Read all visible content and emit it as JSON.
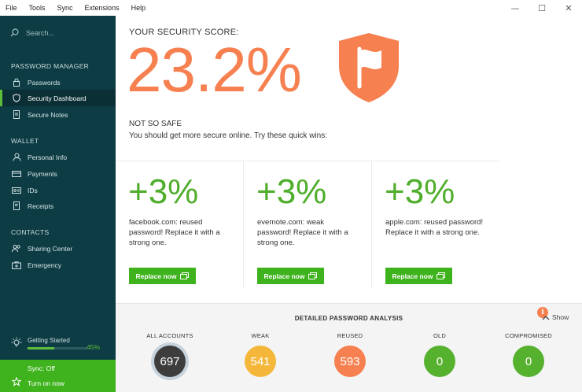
{
  "menu": {
    "items": [
      "File",
      "Tools",
      "Sync",
      "Extensions",
      "Help"
    ]
  },
  "window_controls": {
    "minimize": "—",
    "maximize": "☐",
    "close": "✕"
  },
  "sidebar": {
    "search_placeholder": "Search...",
    "section_password_manager": "PASSWORD MANAGER",
    "section_wallet": "WALLET",
    "section_contacts": "CONTACTS",
    "items": [
      {
        "label": "Passwords",
        "icon": "lock-icon"
      },
      {
        "label": "Security Dashboard",
        "icon": "shield-icon",
        "active": true
      },
      {
        "label": "Secure Notes",
        "icon": "note-icon"
      },
      {
        "label": "Personal Info",
        "icon": "person-icon"
      },
      {
        "label": "Payments",
        "icon": "card-icon"
      },
      {
        "label": "IDs",
        "icon": "id-card-icon"
      },
      {
        "label": "Receipts",
        "icon": "receipt-icon"
      },
      {
        "label": "Sharing Center",
        "icon": "people-icon"
      },
      {
        "label": "Emergency",
        "icon": "first-aid-icon"
      }
    ],
    "getting_started": {
      "label": "Getting Started",
      "percent": "45%",
      "progress": 0.45
    },
    "sync": {
      "status": "Sync: Off",
      "action": "Turn on now"
    }
  },
  "main": {
    "score_label": "YOUR SECURITY SCORE:",
    "score_value": "23.2%",
    "safety_title": "NOT SO SAFE",
    "safety_message": "You should get more secure online. Try these quick wins:",
    "quick_wins": [
      {
        "gain": "+3%",
        "description": "facebook.com: reused password! Replace it with a strong one.",
        "button": "Replace now"
      },
      {
        "gain": "+3%",
        "description": "evernote.com: weak password! Replace it with a strong one.",
        "button": "Replace now"
      },
      {
        "gain": "+3%",
        "description": "apple.com: reused password! Replace it with a strong one.",
        "button": "Replace now"
      }
    ],
    "analysis": {
      "title": "DETAILED PASSWORD ANALYSIS",
      "toggle": "Show",
      "stats": [
        {
          "label": "ALL ACCOUNTS",
          "value": "697",
          "color": "#3d3d3d",
          "selected": true
        },
        {
          "label": "WEAK",
          "value": "541",
          "color": "#f4b73a"
        },
        {
          "label": "REUSED",
          "value": "593",
          "color": "#f6804f"
        },
        {
          "label": "OLD",
          "value": "0",
          "color": "#56b12f"
        },
        {
          "label": "COMPROMISED",
          "value": "0",
          "color": "#56b12f"
        }
      ]
    }
  },
  "colors": {
    "accent_orange": "#f6804f",
    "accent_green": "#3fb31d",
    "sidebar_bg": "#0d3c44"
  }
}
